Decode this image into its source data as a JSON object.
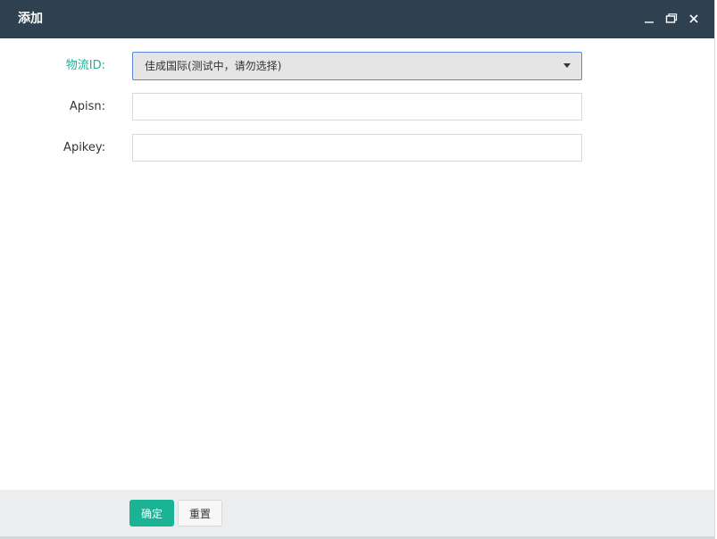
{
  "dialog": {
    "title": "添加",
    "controls": {
      "minimize_icon": "minimize-icon",
      "maximize_icon": "maximize-icon",
      "close_icon": "close-icon"
    }
  },
  "form": {
    "logistics_id": {
      "label": "物流ID:",
      "selected": "佳成国际(测试中，请勿选择)"
    },
    "apisn": {
      "label": "Apisn:",
      "value": "",
      "placeholder": ""
    },
    "apikey": {
      "label": "Apikey:",
      "value": "",
      "placeholder": ""
    }
  },
  "footer": {
    "confirm_label": "确定",
    "reset_label": "重置"
  },
  "colors": {
    "titlebar": "#2f4050",
    "accent": "#1ab394",
    "required_label": "#1ab394",
    "select_focus_border": "#5b86d8"
  }
}
